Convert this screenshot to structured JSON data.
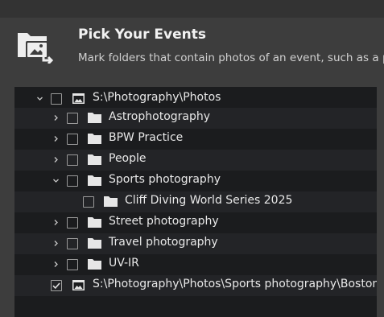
{
  "header": {
    "title": "Pick Your Events",
    "subtitle": "Mark folders that contain photos of an event, such as a photo"
  },
  "tree": {
    "root": {
      "label": "S:\\Photography\\Photos",
      "expanded": true,
      "checked": false
    },
    "folders": [
      {
        "label": "Astrophotography",
        "checked": false
      },
      {
        "label": "BPW Practice",
        "checked": false
      },
      {
        "label": "People",
        "checked": false
      },
      {
        "label": "Sports photography",
        "checked": false,
        "expanded": true
      },
      {
        "label": "Cliff Diving World Series 2025",
        "checked": false
      },
      {
        "label": "Street photography",
        "checked": false
      },
      {
        "label": "Travel photography",
        "checked": false
      },
      {
        "label": "UV-IR",
        "checked": false
      }
    ],
    "second_root": {
      "label": "S:\\Photography\\Photos\\Sports photography\\Boston Marathon",
      "checked": true
    }
  },
  "colors": {
    "background": "#3d3d3d",
    "tree_bg": "#1b1c1e",
    "tree_alt_row": "#232427",
    "text": "#e8e8e8"
  },
  "icons": {
    "header": "event-folders-icon",
    "folder": "folder-icon",
    "drive": "image-folder-icon",
    "expand": "chevron-down-icon",
    "collapse": "chevron-right-icon",
    "check": "checkmark-icon"
  }
}
